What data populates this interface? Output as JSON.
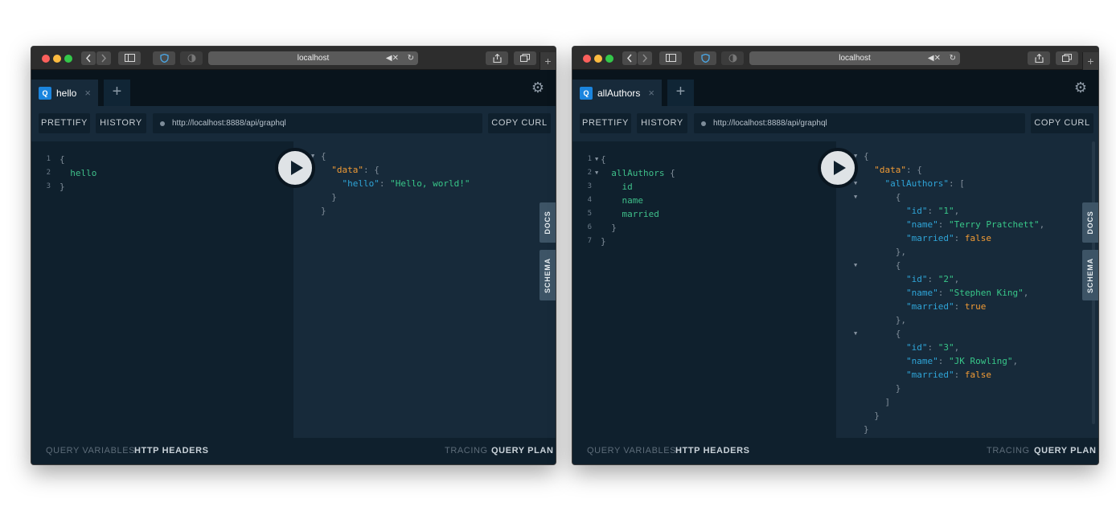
{
  "windows": [
    {
      "browser": {
        "address": "localhost"
      },
      "tab": {
        "badge": "Q",
        "label": "hello",
        "close": "×"
      },
      "toolbar": {
        "prettify": "PRETTIFY",
        "history": "HISTORY",
        "endpoint": "http://localhost:8888/api/graphql",
        "copy_curl": "COPY CURL"
      },
      "side_tabs": {
        "docs": "DOCS",
        "schema": "SCHEMA"
      },
      "bottom": {
        "query_variables": "QUERY VARIABLES",
        "http_headers": "HTTP HEADERS",
        "tracing": "TRACING",
        "query_plan": "QUERY PLAN"
      },
      "query_lines": [
        {
          "num": "1",
          "text": "{"
        },
        {
          "num": "2",
          "text": "  hello"
        },
        {
          "num": "3",
          "text": "}"
        }
      ],
      "result_lines": [
        "{",
        "  \"data\": {",
        "    \"hello\": \"Hello, world!\"",
        "  }",
        "}"
      ]
    },
    {
      "browser": {
        "address": "localhost"
      },
      "tab": {
        "badge": "Q",
        "label": "allAuthors",
        "close": "×"
      },
      "toolbar": {
        "prettify": "PRETTIFY",
        "history": "HISTORY",
        "endpoint": "http://localhost:8888/api/graphql",
        "copy_curl": "COPY CURL"
      },
      "side_tabs": {
        "docs": "DOCS",
        "schema": "SCHEMA"
      },
      "bottom": {
        "query_variables": "QUERY VARIABLES",
        "http_headers": "HTTP HEADERS",
        "tracing": "TRACING",
        "query_plan": "QUERY PLAN"
      },
      "query_lines": [
        {
          "num": "1",
          "text": "{"
        },
        {
          "num": "2",
          "text": "  allAuthors {"
        },
        {
          "num": "3",
          "text": "    id"
        },
        {
          "num": "4",
          "text": "    name"
        },
        {
          "num": "5",
          "text": "    married"
        },
        {
          "num": "6",
          "text": "  }"
        },
        {
          "num": "7",
          "text": "}"
        }
      ],
      "result_lines": [
        "{",
        "  \"data\": {",
        "    \"allAuthors\": [",
        "      {",
        "        \"id\": \"1\",",
        "        \"name\": \"Terry Pratchett\",",
        "        \"married\": false",
        "      },",
        "      {",
        "        \"id\": \"2\",",
        "        \"name\": \"Stephen King\",",
        "        \"married\": true",
        "      },",
        "      {",
        "        \"id\": \"3\",",
        "        \"name\": \"JK Rowling\",",
        "        \"married\": false",
        "      }",
        "    ]",
        "  }",
        "}"
      ]
    }
  ],
  "colors": {
    "playground_bg": "#0f202d",
    "result_bg": "#172a3a",
    "badge_blue": "#1b85de",
    "string_green": "#38c789",
    "key_blue": "#2fa5d8",
    "key_orange": "#f19b35"
  },
  "icons": [
    "back-icon",
    "forward-icon",
    "sidebar-icon",
    "shield-icon",
    "reader-icon",
    "mute-icon",
    "reload-icon",
    "share-icon",
    "tabs-icon",
    "gear-icon",
    "play-icon",
    "plus-icon"
  ]
}
